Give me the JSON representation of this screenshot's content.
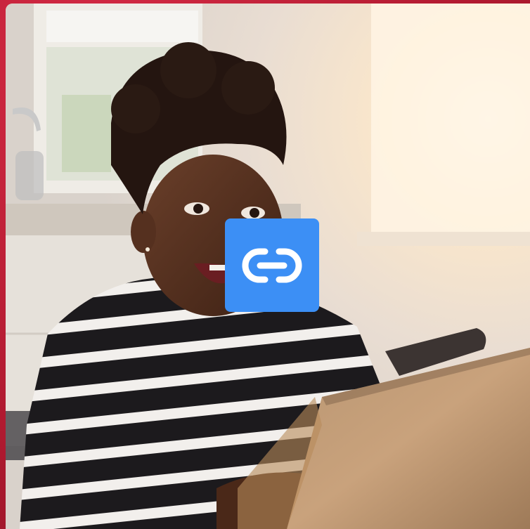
{
  "colors": {
    "frame": "#b81d33",
    "accent": "#3c8ff5",
    "icon": "#ffffff"
  },
  "photo": {
    "subject": "smiling-girl-with-laptop"
  },
  "overlay": {
    "icon": "link-icon"
  }
}
